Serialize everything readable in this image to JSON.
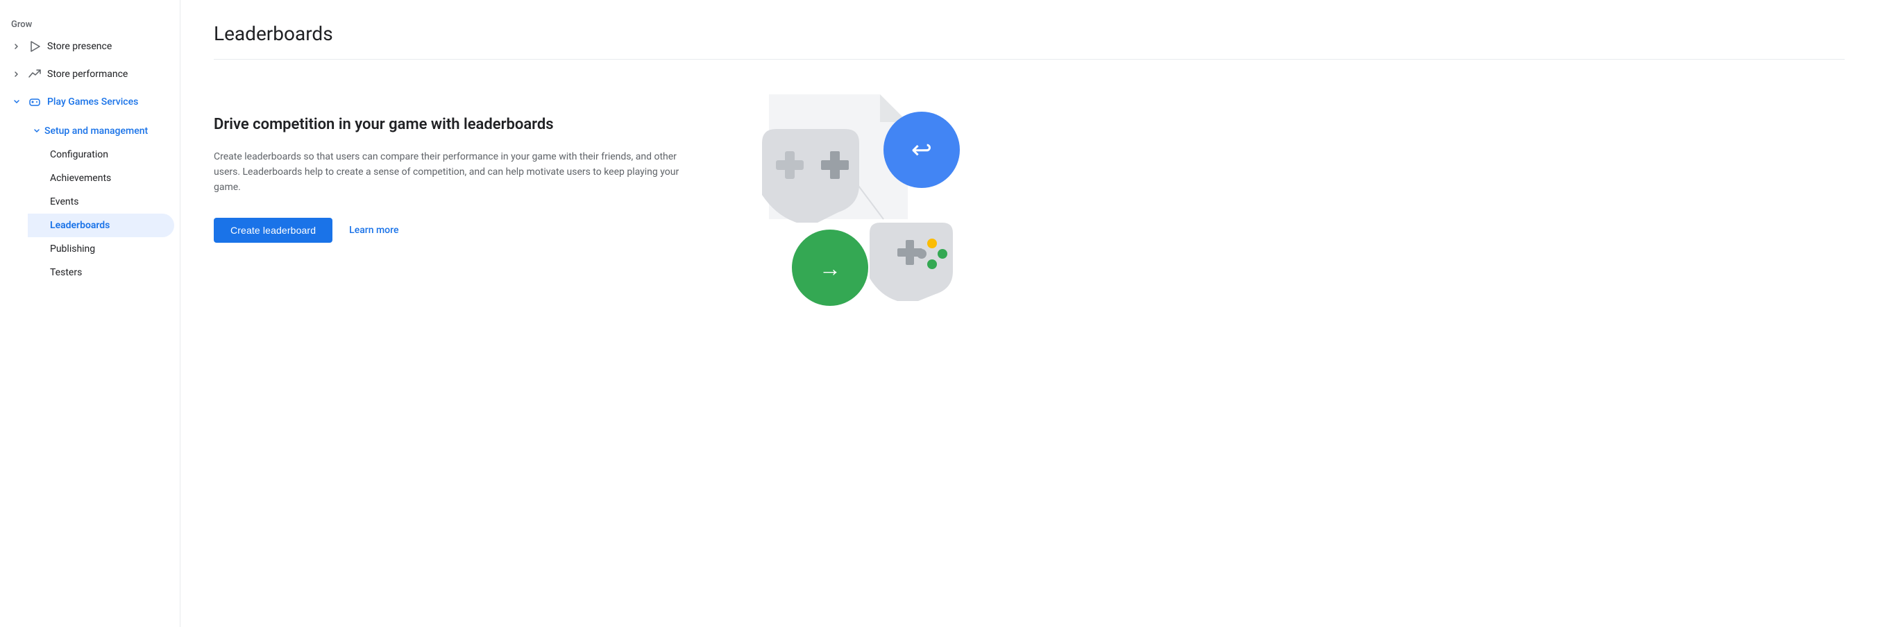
{
  "sidebar": {
    "grow_label": "Grow",
    "items": [
      {
        "id": "store-presence",
        "label": "Store presence",
        "icon": "play-icon",
        "has_arrow": true,
        "expanded": false,
        "active": false
      },
      {
        "id": "store-performance",
        "label": "Store performance",
        "icon": "trending-icon",
        "has_arrow": true,
        "expanded": false,
        "active": false
      },
      {
        "id": "play-games-services",
        "label": "Play Games Services",
        "icon": "gamepad-icon",
        "has_arrow": true,
        "expanded": true,
        "active": true
      }
    ],
    "sub_section": {
      "label": "Setup and management",
      "items": [
        {
          "id": "configuration",
          "label": "Configuration",
          "active": false
        },
        {
          "id": "achievements",
          "label": "Achievements",
          "active": false
        },
        {
          "id": "events",
          "label": "Events",
          "active": false
        },
        {
          "id": "leaderboards",
          "label": "Leaderboards",
          "active": true
        },
        {
          "id": "publishing",
          "label": "Publishing",
          "active": false
        },
        {
          "id": "testers",
          "label": "Testers",
          "active": false
        }
      ]
    }
  },
  "page": {
    "title": "Leaderboards",
    "promo_title": "Drive competition in your game with leaderboards",
    "promo_desc": "Create leaderboards so that users can compare their performance in your game with their friends, and other users. Leaderboards help to create a sense of competition, and can help motivate users to keep playing your game.",
    "create_button": "Create leaderboard",
    "learn_more_link": "Learn more"
  }
}
